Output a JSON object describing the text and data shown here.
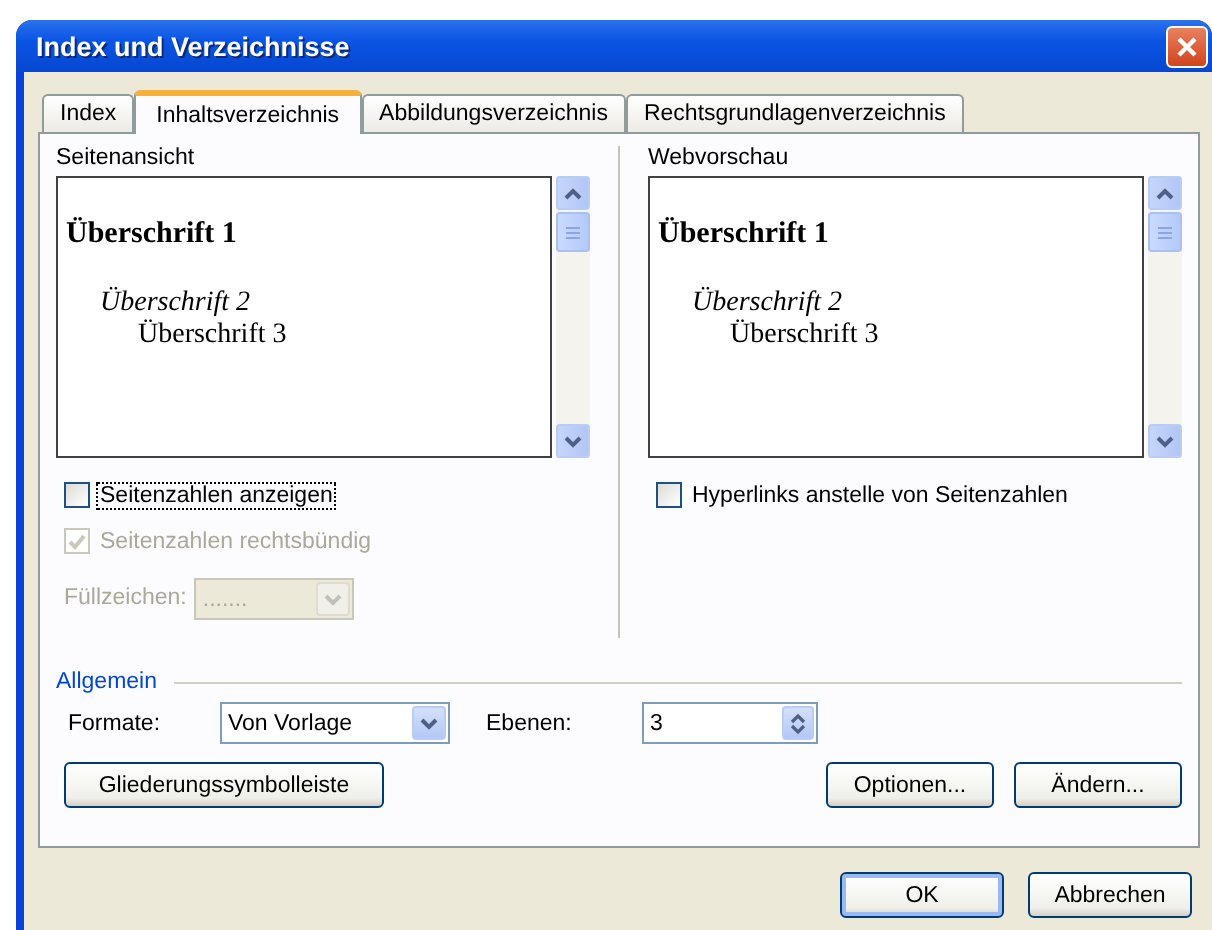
{
  "window": {
    "title": "Index und Verzeichnisse"
  },
  "tabs": [
    {
      "label": "Index",
      "selected": false
    },
    {
      "label": "Inhaltsverzeichnis",
      "selected": true
    },
    {
      "label": "Abbildungsverzeichnis",
      "selected": false
    },
    {
      "label": "Rechtsgrundlagenverzeichnis",
      "selected": false
    }
  ],
  "panes": [
    {
      "label": "Seitenansicht",
      "headings": [
        {
          "text": "Überschrift 1",
          "kind": "heading1"
        },
        {
          "text": "Überschrift 2",
          "kind": "heading2"
        },
        {
          "text": "Überschrift 3",
          "kind": "heading3"
        }
      ],
      "checkboxes": [
        {
          "label": "Seitenzahlen anzeigen",
          "checked": false,
          "disabled": false,
          "focused": true
        },
        {
          "label": "Seitenzahlen rechtsbündig",
          "checked": true,
          "disabled": true,
          "focused": false
        }
      ],
      "fill_char": {
        "label": "Füllzeichen:",
        "value": ".......",
        "disabled": true
      }
    },
    {
      "label": "Webvorschau",
      "headings": [
        {
          "text": "Überschrift 1",
          "kind": "heading1"
        },
        {
          "text": "Überschrift 2",
          "kind": "heading2"
        },
        {
          "text": "Überschrift 3",
          "kind": "heading3"
        }
      ],
      "checkboxes": [
        {
          "label": "Hyperlinks anstelle von Seitenzahlen",
          "checked": false,
          "disabled": false,
          "focused": false
        }
      ]
    }
  ],
  "general": {
    "title": "Allgemein",
    "formats": {
      "label": "Formate:",
      "value": "Von Vorlage"
    },
    "levels": {
      "label": "Ebenen:",
      "value": "3"
    },
    "toolbar_button": "Gliederungssymbolleiste",
    "action_buttons": [
      "Optionen...",
      "Ändern..."
    ]
  },
  "footer_buttons": [
    {
      "label": "OK",
      "default": true
    },
    {
      "label": "Abbrechen",
      "default": false
    }
  ]
}
